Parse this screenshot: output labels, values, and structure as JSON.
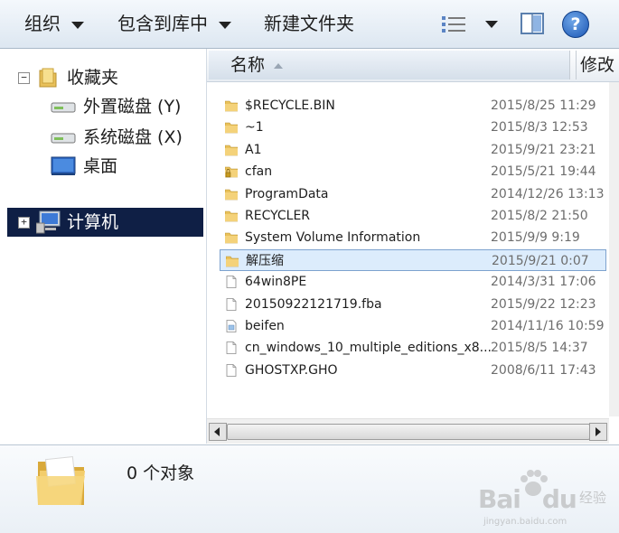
{
  "toolbar": {
    "organize": "组织",
    "include_in_library": "包含到库中",
    "new_folder": "新建文件夹",
    "views_icon": "view-list-icon",
    "preview_icon": "preview-pane-icon",
    "help_label": "?"
  },
  "nav": {
    "favorites": {
      "expander": "−",
      "label": "收藏夹"
    },
    "items": [
      {
        "label": "外置磁盘 (Y)",
        "icon": "drive-icon"
      },
      {
        "label": "系统磁盘 (X)",
        "icon": "drive-icon"
      },
      {
        "label": "桌面",
        "icon": "desktop-icon"
      }
    ],
    "computer": {
      "expander": "+",
      "label": "计算机"
    }
  },
  "columns": {
    "name": "名称",
    "modified": "修改"
  },
  "files": [
    {
      "name": "$RECYCLE.BIN",
      "date": "2015/8/25 11:29",
      "type": "folder"
    },
    {
      "name": "~1",
      "date": "2015/8/3 12:53",
      "type": "folder"
    },
    {
      "name": "A1",
      "date": "2015/9/21 23:21",
      "type": "folder"
    },
    {
      "name": "cfan",
      "date": "2015/5/21 19:44",
      "type": "folder-locked"
    },
    {
      "name": "ProgramData",
      "date": "2014/12/26 13:13",
      "type": "folder"
    },
    {
      "name": "RECYCLER",
      "date": "2015/8/2 21:50",
      "type": "folder"
    },
    {
      "name": "System Volume Information",
      "date": "2015/9/9 9:19",
      "type": "folder"
    },
    {
      "name": "解压缩",
      "date": "2015/9/21 0:07",
      "type": "folder",
      "selected": true
    },
    {
      "name": "64win8PE",
      "date": "2014/3/31 17:06",
      "type": "file"
    },
    {
      "name": "20150922121719.fba",
      "date": "2015/9/22 12:23",
      "type": "file"
    },
    {
      "name": "beifen",
      "date": "2014/11/16 10:59",
      "type": "file-image"
    },
    {
      "name": "cn_windows_10_multiple_editions_x8...",
      "date": "2015/8/5 14:37",
      "type": "file"
    },
    {
      "name": "GHOSTXP.GHO",
      "date": "2008/6/11 17:43",
      "type": "file"
    }
  ],
  "details": {
    "count": "0 个对象"
  },
  "watermark": {
    "logo": "Bai",
    "logo2": "du",
    "sub": "经验",
    "url": "jingyan.baidu.com"
  },
  "colors": {
    "selection_nav": "#0f1f45",
    "selection_file": "#dcecfc",
    "folder": "#e9c15a"
  }
}
